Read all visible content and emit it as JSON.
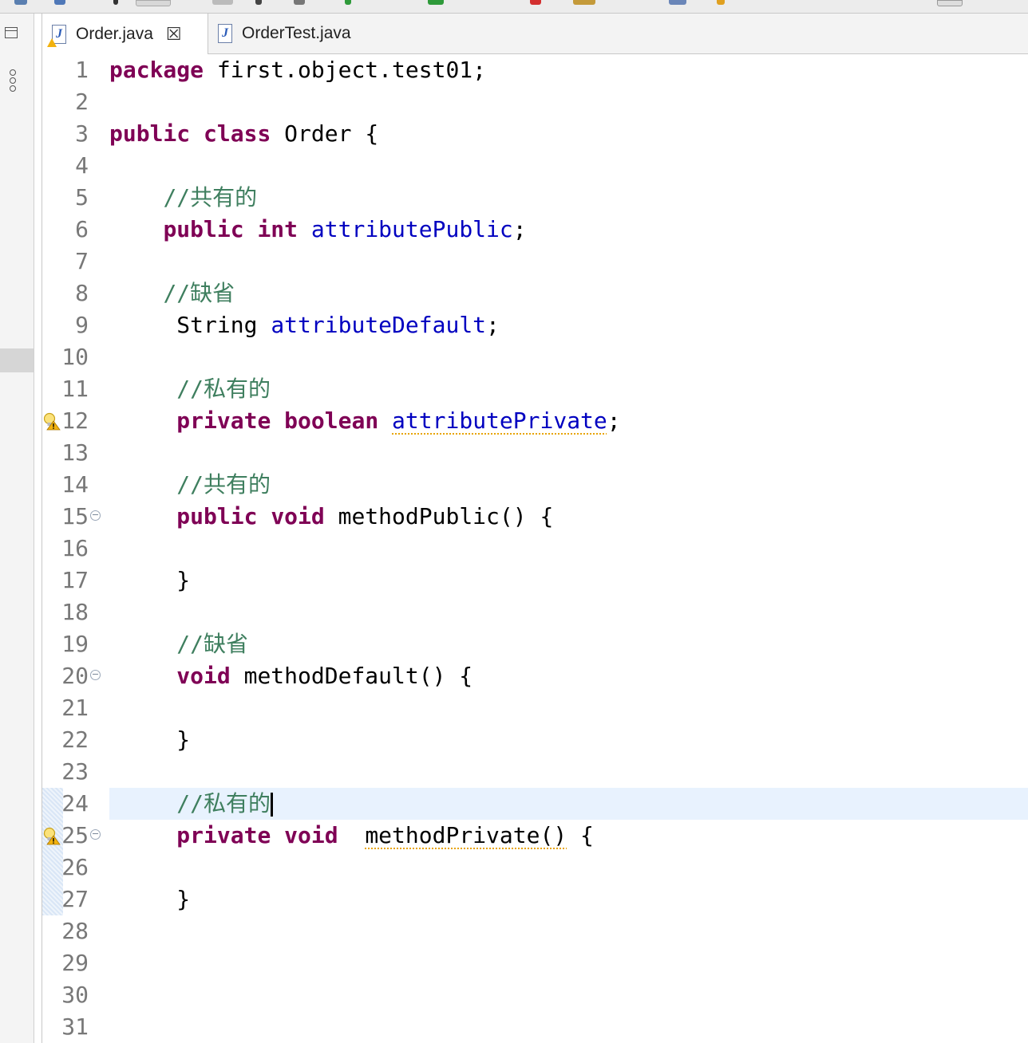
{
  "tabs": [
    {
      "label": "Order.java",
      "active": true,
      "icon": "java-file-warning-icon"
    },
    {
      "label": "OrderTest.java",
      "active": false,
      "icon": "java-file-icon"
    }
  ],
  "code_lines": [
    {
      "num": "1"
    },
    {
      "num": "2"
    },
    {
      "num": "3"
    },
    {
      "num": "4"
    },
    {
      "num": "5"
    },
    {
      "num": "6"
    },
    {
      "num": "7"
    },
    {
      "num": "8"
    },
    {
      "num": "9"
    },
    {
      "num": "10"
    },
    {
      "num": "11"
    },
    {
      "num": "12",
      "marker": "warning-bulb-icon"
    },
    {
      "num": "13"
    },
    {
      "num": "14"
    },
    {
      "num": "15",
      "fold": true
    },
    {
      "num": "16"
    },
    {
      "num": "17"
    },
    {
      "num": "18"
    },
    {
      "num": "19"
    },
    {
      "num": "20",
      "fold": true
    },
    {
      "num": "21"
    },
    {
      "num": "22"
    },
    {
      "num": "23"
    },
    {
      "num": "24"
    },
    {
      "num": "25",
      "marker": "warning-bulb-icon",
      "fold": true
    },
    {
      "num": "26"
    },
    {
      "num": "27"
    },
    {
      "num": "28"
    },
    {
      "num": "29"
    },
    {
      "num": "30"
    },
    {
      "num": "31"
    }
  ],
  "code": {
    "l1_kw": "package",
    "l1_rest": " first.object.test01;",
    "l3_kw1": "public",
    "l3_kw2": "class",
    "l3_rest": " Order {",
    "l5_cmt": "//共有的",
    "l6_kw1": "public",
    "l6_kw2": "int",
    "l6_fld": "attributePublic",
    "l6_end": ";",
    "l8_cmt": "//缺省",
    "l9_type": "String ",
    "l9_fld": "attributeDefault",
    "l9_end": ";",
    "l11_cmt": "//私有的",
    "l12_kw1": "private",
    "l12_kw2": "boolean",
    "l12_fld": "attributePrivate",
    "l12_end": ";",
    "l14_cmt": "//共有的",
    "l15_kw1": "public",
    "l15_kw2": "void",
    "l15_rest": " methodPublic() {",
    "l17_brace": "}",
    "l19_cmt": "//缺省",
    "l20_kw": "void",
    "l20_rest": " methodDefault() {",
    "l22_brace": "}",
    "l24_cmt": "//私有的",
    "l25_kw1": "private",
    "l25_kw2": "void",
    "l25_method": "methodPrivate()",
    "l25_end": " {",
    "l27_brace": "}"
  },
  "colors": {
    "keyword": "#7f0055",
    "field": "#0000c0",
    "comment": "#3f7f5f",
    "line_number": "#787878",
    "current_line": "#e8f2fe",
    "warning": "#e8a400"
  }
}
